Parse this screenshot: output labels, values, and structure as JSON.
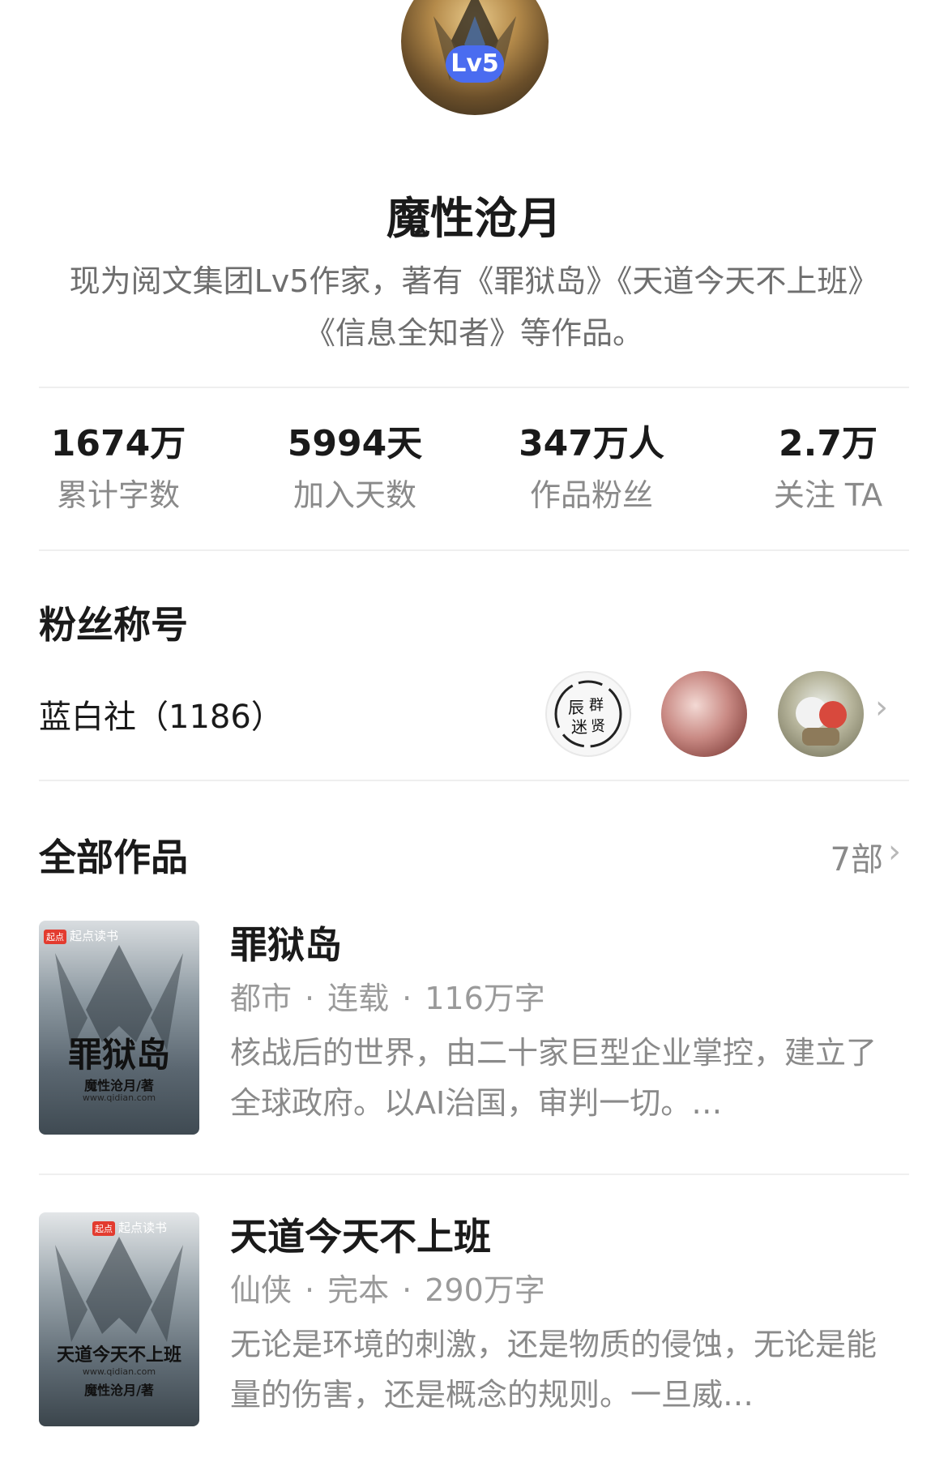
{
  "profile": {
    "level_badge": "Lv5",
    "name": "魔性沧月",
    "bio": "现为阅文集团Lv5作家，著有《罪狱岛》《天道今天不上班》《信息全知者》等作品。"
  },
  "stats": [
    {
      "value": "1674万",
      "label": "累计字数"
    },
    {
      "value": "5994天",
      "label": "加入天数"
    },
    {
      "value": "347万人",
      "label": "作品粉丝"
    },
    {
      "value": "2.7万",
      "label": "关注 TA"
    }
  ],
  "fans": {
    "title": "粉丝称号",
    "club_label": "蓝白社（1186）",
    "avatar_1_text": "辰群迷贤",
    "avatar_icons": [
      "fan-avatar-calligraphy",
      "fan-avatar-photo",
      "fan-avatar-anime"
    ]
  },
  "works": {
    "title": "全部作品",
    "count": "7部",
    "books": [
      {
        "title": "罪狱岛",
        "genre": "都市",
        "status": "连载",
        "words": "116万字",
        "description": "核战后的世界，由二十家巨型企业掌控，建立了全球政府。以AI治国，审判一切。…",
        "cover_brand": "起点读书",
        "cover_tag": "起点",
        "cover_title": "罪狱岛",
        "cover_author": "魔性沧月/著",
        "cover_site": "www.qidian.com"
      },
      {
        "title": "天道今天不上班",
        "genre": "仙侠",
        "status": "完本",
        "words": "290万字",
        "description": "无论是环境的刺激，还是物质的侵蚀，无论是能量的伤害，还是概念的规则。一旦威…",
        "cover_brand": "起点读书",
        "cover_tag": "起点",
        "cover_title": "天道今天不上班",
        "cover_author": "魔性沧月/著",
        "cover_site": "www.qidian.com"
      }
    ]
  },
  "icons": {
    "chevron": "›",
    "meta_separator": "·"
  },
  "colors": {
    "level_badge": "#4a6cf0",
    "cover_tag": "#e33b2f"
  }
}
